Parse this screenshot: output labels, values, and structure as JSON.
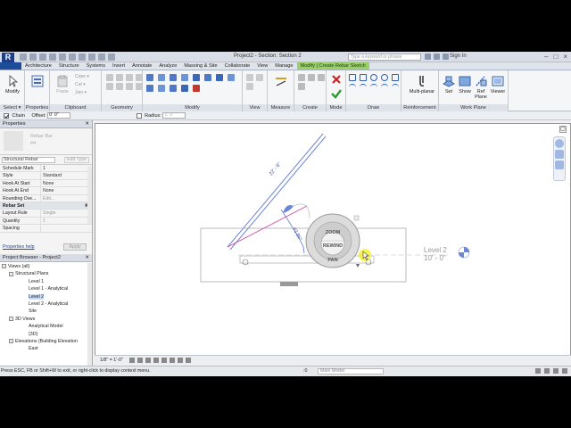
{
  "title": {
    "app_logo": "R",
    "document": "Project2 - Section: Section 2",
    "search_placeholder": "Type a keyword or phrase",
    "sign_in": "Sign In"
  },
  "tabs": [
    "Architecture",
    "Structure",
    "Systems",
    "Insert",
    "Annotate",
    "Analyze",
    "Massing & Site",
    "Collaborate",
    "View",
    "Manage",
    "Modify | Create Rebar Sketch"
  ],
  "ribbon": {
    "select": "Select ▾",
    "modify": "Modify",
    "properties": "Properties",
    "clipboard": "Clipboard",
    "clipboard_items": [
      "Cope ▾",
      "Cut ▾",
      "Join ▾"
    ],
    "paste": "Paste",
    "geometry": "Geometry",
    "modify_panel": "Modify",
    "view": "View",
    "measure": "Measure",
    "create": "Create",
    "mode": "Mode",
    "draw": "Draw",
    "multiplanar": "Multi-planar",
    "reinforcement": "Reinforcement",
    "set": "Set",
    "show": "Show",
    "ref_plane": "Ref Plane",
    "viewer": "Viewer",
    "work_plane": "Work Plane"
  },
  "options_bar": {
    "chain_label": "Chain",
    "offset_label": "Offset:",
    "offset_value": "0'  0\"",
    "radius_label": "Radius:",
    "radius_value": "1'  0\""
  },
  "properties": {
    "header": "Properties",
    "type_name": "Rebar Bar",
    "type_sub": "#4",
    "filter": "Structural Rebar",
    "edit_type": "Edit Type",
    "rows": [
      {
        "k": "Schedule Mark",
        "v": "1"
      },
      {
        "k": "Style",
        "v": "Standard"
      },
      {
        "k": "Hook At Start",
        "v": "None"
      },
      {
        "k": "Hook At End",
        "v": "None"
      },
      {
        "k": "Rounding Ove...",
        "v": "Edit..."
      }
    ],
    "group": "Rebar Set",
    "rows2": [
      {
        "k": "Layout Rule",
        "v": "Single"
      },
      {
        "k": "Quantity",
        "v": "1"
      },
      {
        "k": "Spacing",
        "v": ""
      }
    ],
    "help": "Properties help",
    "apply": "Apply"
  },
  "browser": {
    "header": "Project Browser - Project2",
    "items": [
      "Views (all)",
      "Structural Plans",
      "Level 1",
      "Level 1 - Analytical",
      "Level 2",
      "Level 2 - Analytical",
      "Site",
      "3D Views",
      "Analytical Model",
      "{3D}",
      "Elevations (Building Elevation",
      "East"
    ]
  },
  "canvas": {
    "dim_long": "22' - 6\"",
    "dim_angle": "43.86°",
    "level_name": "Level 2",
    "level_elev": "10' - 0\"",
    "wheel": {
      "zoom": "ZOOM",
      "rewind": "REWIND",
      "pan": "PAN"
    }
  },
  "view_control": {
    "scale": "1/8\" = 1'-0\""
  },
  "status": {
    "message": "Press ESC, FB or Shift+W to exit, or right-click to display context menu.",
    "model": "Main Model",
    "zero": ":0"
  },
  "colors": {
    "context_tab": "#9bcf6a",
    "rebar_line": "#6f86d6",
    "selection": "#c7d9f5"
  }
}
